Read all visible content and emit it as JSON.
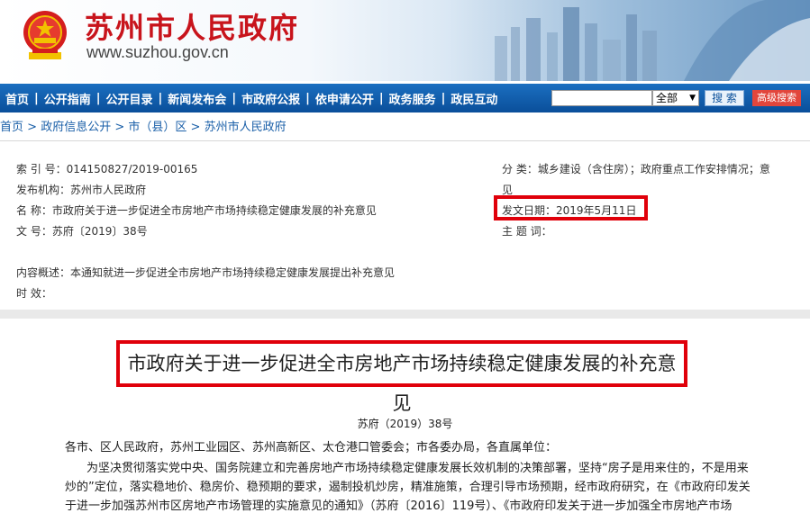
{
  "header": {
    "site_title": "苏州市人民政府",
    "site_url": "www.suzhou.gov.cn",
    "emblem_icon": "national-emblem-icon"
  },
  "nav": {
    "items": [
      "首页",
      "公开指南",
      "公开目录",
      "新闻发布会",
      "市政府公报",
      "依申请公开",
      "政务服务",
      "政民互动"
    ],
    "select_value": "全部",
    "search_label": "搜 索",
    "advanced_label": "高级搜索"
  },
  "breadcrumb": [
    "首页",
    "政府信息公开",
    "市（县）区",
    "苏州市人民政府"
  ],
  "meta": {
    "index_no": "索 引 号：014150827/2019-00165",
    "category_a": "分    类：城乡建设（含住房）；政府重点工作安排情况；意",
    "category_b": "见",
    "issuer": "发布机构：苏州市人民政府",
    "issue_date": "发文日期：2019年5月11日",
    "name": "名    称：市政府关于进一步促进全市房地产市场持续稳定健康发展的补充意见",
    "doc_no": "文    号：苏府〔2019〕38号",
    "subject": "主 题 词：",
    "summary": "内容概述：本通知就进一步促进全市房地产市场持续稳定健康发展提出补充意见",
    "validity": "时    效："
  },
  "document": {
    "title": "市政府关于进一步促进全市房地产市场持续稳定健康发展的补充意见",
    "number": "苏府（2019）38号",
    "recipients": "各市、区人民政府，苏州工业园区、苏州高新区、太仓港口管委会；市各委办局，各直属单位：",
    "para1_line1": "为坚决贯彻落实党中央、国务院建立和完善房地产市场持续稳定健康发展长效机制的决策部署，坚持“房子是用来住的，不是用来",
    "para1_line2": "炒的”定位，落实稳地价、稳房价、稳预期的要求，遏制投机炒房，精准施策，合理引导市场预期，经市政府研究，在《市政府印发关",
    "para1_line3": "于进一步加强苏州市区房地产市场管理的实施意见的通知》（苏府〔2016〕119号）、《市政府印发关于进一步加强全市房地产市场"
  },
  "colors": {
    "brand_red": "#c8141c",
    "nav_blue": "#0a4f9a",
    "highlight_red": "#e0000a",
    "link_blue": "#1a5fa8"
  }
}
